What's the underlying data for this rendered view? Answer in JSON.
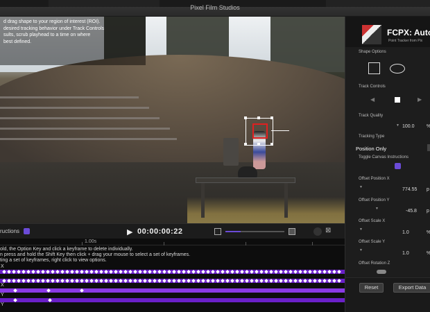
{
  "app": {
    "window_title": "Pixel Film Studios"
  },
  "overlay_instructions": [
    "d drag shape to your region of interest (ROI).",
    "desired tracking behavior under Track Controls",
    "sults, scrub playhead to a time on where",
    "best defined."
  ],
  "playback": {
    "instructions_label": "ructions",
    "play_glyph": "▶",
    "timecode": "00:00:00:22",
    "camera_glyph": "⊠"
  },
  "timeline": {
    "ruler_label": "1.00s",
    "help_lines": [
      "old, the Option Key and click a keyframe to delete individually.",
      "n press and hold the Shift Key then click + drag your mouse to select a set of keyframes.",
      "ting a set of keyframes, right click to view options."
    ],
    "track_labels": [
      "X",
      "",
      "X",
      "Y",
      "Y"
    ]
  },
  "panel": {
    "logo_title": "FCPX: Auto",
    "logo_subtitle": "Point Tracker from Pix",
    "shape_options_label": "Shape Options",
    "track_controls_label": "Track Controls",
    "track_controls_icons": {
      "back": "◀",
      "forward": "▶"
    },
    "track_quality_label": "Track Quality",
    "track_quality_value": "100.0",
    "tracking_type_label": "Tracking Type",
    "tracking_type_value": "Position Only",
    "toggle_label": "Toggle Canvas Instructions",
    "offset_x_label": "Offset Position X",
    "offset_x_value": "774.55",
    "offset_y_label": "Offset Position Y",
    "offset_y_value": "-45.8",
    "scale_x_label": "Offset Scale X",
    "scale_x_value": "1.0",
    "scale_y_label": "Offset Scale Y",
    "scale_y_value": "1.0",
    "rotation_z_label": "Offset Rotation Z",
    "percent_unit": "%",
    "px_unit": "p",
    "reset_label": "Reset",
    "export_label": "Export Data"
  },
  "colors": {
    "accent": "#6b4bd8",
    "track": "#6a20c8",
    "roi_inner": "#e02020"
  }
}
